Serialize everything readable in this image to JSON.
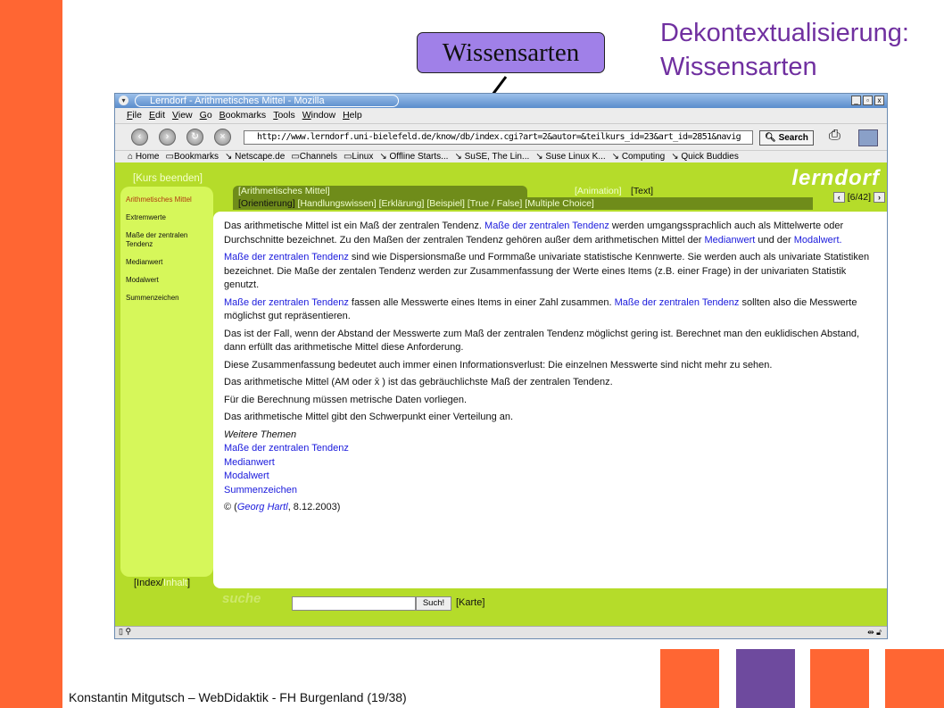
{
  "slide": {
    "title_line1": "Dekontextualisierung:",
    "title_line2": "Wissensarten",
    "callout": "Wissensarten",
    "footer": "Konstantin Mitgutsch – WebDidaktik - FH Burgenland  (19/38)",
    "colors": {
      "orange": "#ff6633",
      "purple": "#6e4a9e",
      "title": "#7030a0"
    }
  },
  "browser": {
    "title": "Lerndorf - Arithmetisches Mittel - Mozilla",
    "menu": [
      "File",
      "Edit",
      "View",
      "Go",
      "Bookmarks",
      "Tools",
      "Window",
      "Help"
    ],
    "url": "http://www.lerndorf.uni-bielefeld.de/know/db/index.cgi?art=2&autor=&teilkurs_id=23&art_id=2851&navig",
    "search_label": "Search",
    "bookmarks": [
      "⌂ Home",
      "▭Bookmarks",
      "↘ Netscape.de",
      "▭Channels",
      "▭Linux",
      "↘ Offline Starts...",
      "↘ SuSE, The Lin...",
      "↘ Suse Linux K...",
      "↘ Computing",
      "↘ Quick Buddies"
    ]
  },
  "page": {
    "logo": "lerndorf",
    "kurs_beenden": "[Kurs beenden]",
    "sidebar": [
      {
        "label": "Arithmetisches Mittel",
        "active": true
      },
      {
        "label": "Extremwerte"
      },
      {
        "label": "Maße der zentralen Tendenz"
      },
      {
        "label": "Medianwert"
      },
      {
        "label": "Modalwert"
      },
      {
        "label": "Summenzeichen"
      }
    ],
    "topic_tab": "[Arithmetisches Mittel]",
    "view_tabs": [
      "[Animation]",
      "[Text]"
    ],
    "kind_tabs": [
      "[Orientierung]",
      "[Handlungswissen]",
      "[Erklärung]",
      "[Beispiel]",
      "[True / False]",
      "[Multiple Choice]"
    ],
    "pager": "[6/42]",
    "paragraphs": [
      [
        {
          "t": "Das arithmetische Mittel ist ein Maß der zentralen Tendenz. "
        },
        {
          "t": "Maße der zentralen Tendenz",
          "link": true
        },
        {
          "t": " werden umgangssprachlich auch als Mittelwerte oder Durchschnitte bezeichnet. Zu den Maßen der zentralen Tendenz gehören außer dem arithmetischen Mittel der "
        },
        {
          "t": "Medianwert",
          "link": true
        },
        {
          "t": " und der "
        },
        {
          "t": "Modalwert.",
          "link": true
        }
      ],
      [
        {
          "t": "Maße der zentralen Tendenz",
          "link": true
        },
        {
          "t": " sind wie Dispersionsmaße und Formmaße univariate statistische Kennwerte. Sie werden auch als univariate Statistiken bezeichnet. Die Maße der zentalen Tendenz werden zur Zusammenfassung der Werte eines Items (z.B. einer Frage) in der univariaten Statistik genutzt."
        }
      ],
      [
        {
          "t": "Maße der zentralen Tendenz",
          "link": true
        },
        {
          "t": " fassen alle Messwerte eines Items in einer Zahl zusammen. "
        },
        {
          "t": "Maße der zentralen Tendenz",
          "link": true
        },
        {
          "t": " sollten also die Messwerte möglichst gut repräsentieren."
        }
      ],
      [
        {
          "t": "Das ist der Fall, wenn der Abstand der Messwerte zum Maß der zentralen Tendenz möglichst gering ist. Berechnet man den euklidischen Abstand, dann erfüllt das arithmetische Mittel diese Anforderung."
        }
      ],
      [
        {
          "t": "Diese Zusammenfassung bedeutet auch immer einen Informationsverlust: Die einzelnen Messwerte sind nicht mehr zu sehen."
        }
      ],
      [
        {
          "t": " Das arithmetische Mittel (AM oder x̄ ) ist das gebräuchlichste Maß der zentralen Tendenz."
        }
      ],
      [
        {
          "t": "Für die Berechnung müssen metrische Daten vorliegen."
        }
      ],
      [
        {
          "t": "Das arithmetische Mittel gibt den Schwerpunkt einer Verteilung an."
        }
      ]
    ],
    "further_heading": "Weitere Themen",
    "further_links": [
      "Maße der zentralen Tendenz",
      "Medianwert",
      "Modalwert",
      "Summenzeichen"
    ],
    "copyright": [
      {
        "t": "© ("
      },
      {
        "t": "Georg Hartl",
        "link": true,
        "italic": true
      },
      {
        "t": ", 8.12.2003)"
      }
    ],
    "index_label": "[Index/",
    "inhalt_label": "Inhalt",
    "index_close": "]",
    "suche_logo": "suche",
    "search_button": "Such!",
    "karte": "[Karte]"
  }
}
